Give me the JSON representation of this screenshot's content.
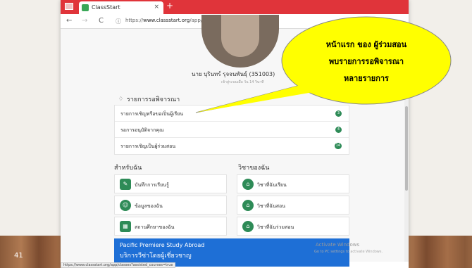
{
  "tab": {
    "title": "ClassStart",
    "close": "×",
    "new": "+"
  },
  "toolbar": {
    "back": "←",
    "forward": "→",
    "reload": "C",
    "lock": "ⓘ",
    "url_prefix": "https://",
    "url_domain": "www.classstart.org",
    "url_path": "/app/home"
  },
  "profile": {
    "name": "นาย บุรินทร์ รุจจนพันธุ์ (351003)",
    "sub": "เข้าสู่ระบบเมื่อ วัน 14 วินาที"
  },
  "pending": {
    "icon": "bell-icon",
    "title": "รายการรอพิจารณา",
    "items": [
      {
        "label": "รายการเชิญหรือขอเป็นผู้เรียน",
        "count": "3"
      },
      {
        "label": "รอการอนุมัติจากคุณ",
        "count": "4"
      },
      {
        "label": "รายการเชิญเป็นผู้ร่วมสอน",
        "count": "14"
      }
    ]
  },
  "for_you": {
    "title": "สำหรับฉัน",
    "items": [
      {
        "label": "บันทึกการเรียนรู้",
        "icon": "notebook-icon",
        "glyph": "✎"
      },
      {
        "label": "ข้อมูลของฉัน",
        "icon": "people-icon",
        "glyph": "☺"
      },
      {
        "label": "สถานศึกษาของฉัน",
        "icon": "school-icon",
        "glyph": "▦"
      }
    ]
  },
  "my_courses": {
    "title": "วิชาของฉัน",
    "items": [
      {
        "label": "วิชาที่ฉันเรียน",
        "icon": "home-icon",
        "glyph": "⌂"
      },
      {
        "label": "วิชาที่ฉันสอน",
        "icon": "home-icon",
        "glyph": "⌂"
      },
      {
        "label": "วิชาที่ฉันร่วมสอน",
        "icon": "home-icon",
        "glyph": "⌂"
      }
    ]
  },
  "ad": {
    "title": "Pacific Premiere Study Abroad",
    "subtitle": "บริการวีซ่าโดยผู้เชี่ยวชาญ",
    "tail": "miere"
  },
  "watermark": {
    "title": "Activate Windows",
    "sub": "Go to PC settings to activate Windows."
  },
  "statusbar": {
    "url": "https://www.classstart.org/app/classes?assisted_courses=true"
  },
  "callout": {
    "line1": "หน้าแรก ของ ผู้ร่วมสอน",
    "line2": "พบรายการรอพิจารณา",
    "line3": "หลายรายการ"
  },
  "slide": {
    "number": "41"
  },
  "colors": {
    "tabbar": "#e0343a",
    "accent": "#2e8b57",
    "callout": "#ffff00",
    "ad": "#1e6fd6"
  }
}
